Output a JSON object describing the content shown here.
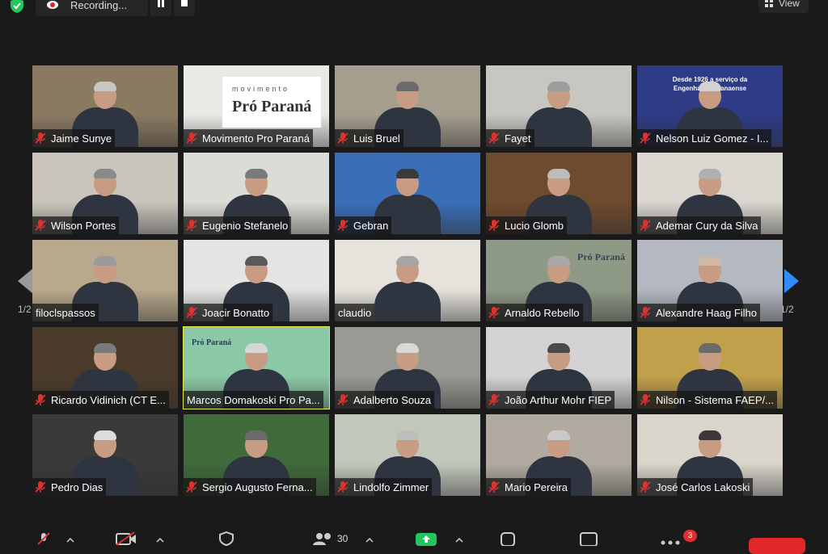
{
  "recording": {
    "label": "Recording..."
  },
  "view_button": {
    "label": "View"
  },
  "pager": {
    "page_text": "1/2"
  },
  "participants": [
    {
      "name": "Jaime Sunye",
      "muted": true,
      "bg": "#8a7a62",
      "hair": "#c7c7c7"
    },
    {
      "name": "Movimento Pro Paraná",
      "muted": true,
      "bg": "#e9e9e6",
      "logo": "Pró Paraná",
      "logo_top": "movimento"
    },
    {
      "name": "Luis Bruel",
      "muted": true,
      "bg": "#a59d8e",
      "hair": "#6b6b6b"
    },
    {
      "name": "Fayet",
      "muted": true,
      "bg": "#c8c6c0",
      "hair": "#9d9d9d"
    },
    {
      "name": "Nelson Luiz Gomez - I...",
      "muted": true,
      "bg": "#2e3c86",
      "banner": "Desde 1926 a serviço da Engenharia paranaense",
      "hair": "#d2d2d2"
    },
    {
      "name": "Wilson Portes",
      "muted": true,
      "bg": "#c9c5bc",
      "hair": "#8a8a8a"
    },
    {
      "name": "Eugenio Stefanelo",
      "muted": true,
      "bg": "#dcdcd6",
      "hair": "#7a7a7a"
    },
    {
      "name": "Gebran",
      "muted": true,
      "bg": "#3a6fb8",
      "hair": "#3a3a3a"
    },
    {
      "name": "Lucio Glomb",
      "muted": true,
      "bg": "#6e4a2e",
      "hair": "#bcbcbc"
    },
    {
      "name": "Ademar Cury da Silva",
      "muted": true,
      "bg": "#d9d7cf",
      "hair": "#b0b0b0"
    },
    {
      "name": "filoclspassos",
      "muted": false,
      "bg": "#b9a98c",
      "hair": "#9a9a9a"
    },
    {
      "name": "Joacir Bonatto",
      "muted": true,
      "bg": "#e4e4e2",
      "hair": "#5a5a5a"
    },
    {
      "name": "claudio",
      "muted": false,
      "bg": "#e6e3dc",
      "hair": "#a5a5a5"
    },
    {
      "name": "Arnaldo Rebello",
      "muted": true,
      "bg": "#8f9a86",
      "logo": "Pró Paraná",
      "hair": "#a9a9a9"
    },
    {
      "name": "Alexandre Haag Filho",
      "muted": true,
      "bg": "#b4b8c0",
      "hair": "#d0b8a8"
    },
    {
      "name": "Ricardo Vidinich (CT E...",
      "muted": true,
      "bg": "#4a3a2a",
      "hair": "#7a7a7a"
    },
    {
      "name": "Marcos Domakoski Pro Pa...",
      "muted": false,
      "bg": "#8bc9a6",
      "active": true,
      "logo": "Pró Paraná",
      "hair": "#d6d6d6"
    },
    {
      "name": "Adalberto Souza",
      "muted": true,
      "bg": "#9a9a94",
      "hair": "#d8d8d8"
    },
    {
      "name": "João Arthur Mohr FIEP",
      "muted": true,
      "bg": "#d3d3d3",
      "hair": "#4a4a4a"
    },
    {
      "name": "Nilson - Sistema FAEP/...",
      "muted": true,
      "bg": "#c0a04a",
      "hair": "#6a6a6a"
    },
    {
      "name": "Pedro Dias",
      "muted": true,
      "bg": "#3a3a3a",
      "hair": "#dcdcdc"
    },
    {
      "name": "Sergio Augusto Ferna...",
      "muted": true,
      "bg": "#3f6a3a",
      "hair": "#6a6a6a"
    },
    {
      "name": "Lindolfo Zimmer",
      "muted": true,
      "bg": "#c2c7bc",
      "hair": "#bdbdbd"
    },
    {
      "name": "Mario Pereira",
      "muted": true,
      "bg": "#b0aaa0",
      "hair": "#c9c9c9"
    },
    {
      "name": "José Carlos Lakoski",
      "muted": true,
      "bg": "#d9d5cc",
      "hair": "#3a3a3a"
    }
  ],
  "toolbar": {
    "participants_count": "30",
    "chat_badge": "3"
  },
  "colors": {
    "background": "#1a1a1a",
    "active_speaker_outline": "#e5e84f",
    "muted_icon": "#e0302f",
    "share_green": "#22c55e",
    "end_red": "#e02828",
    "pager_blue": "#2d8cff"
  },
  "icons": [
    "shield-check-icon",
    "record-icon",
    "pause-icon",
    "stop-icon",
    "grid-view-icon",
    "muted-mic-icon",
    "previous-page-icon",
    "next-page-icon",
    "video-off-icon",
    "security-icon",
    "participants-icon",
    "share-screen-icon",
    "reactions-icon",
    "more-icon"
  ]
}
